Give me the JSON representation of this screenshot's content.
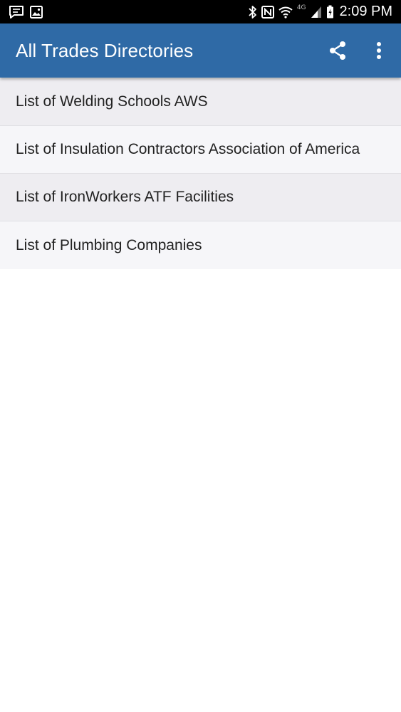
{
  "status_bar": {
    "time": "2:09 PM",
    "network_label": "4G",
    "icons": [
      "message-icon",
      "image-icon",
      "bluetooth-icon",
      "nfc-icon",
      "wifi-icon",
      "signal-icon",
      "battery-icon"
    ]
  },
  "app_bar": {
    "title": "All Trades Directories",
    "background": "#2f6aa6",
    "actions": [
      "share-icon",
      "more-vert-icon"
    ]
  },
  "list": {
    "items": [
      {
        "label": "List of Welding Schools AWS"
      },
      {
        "label": "List of Insulation Contractors Association of America"
      },
      {
        "label": "List of IronWorkers ATF Facilities"
      },
      {
        "label": "List of Plumbing Companies"
      }
    ]
  }
}
